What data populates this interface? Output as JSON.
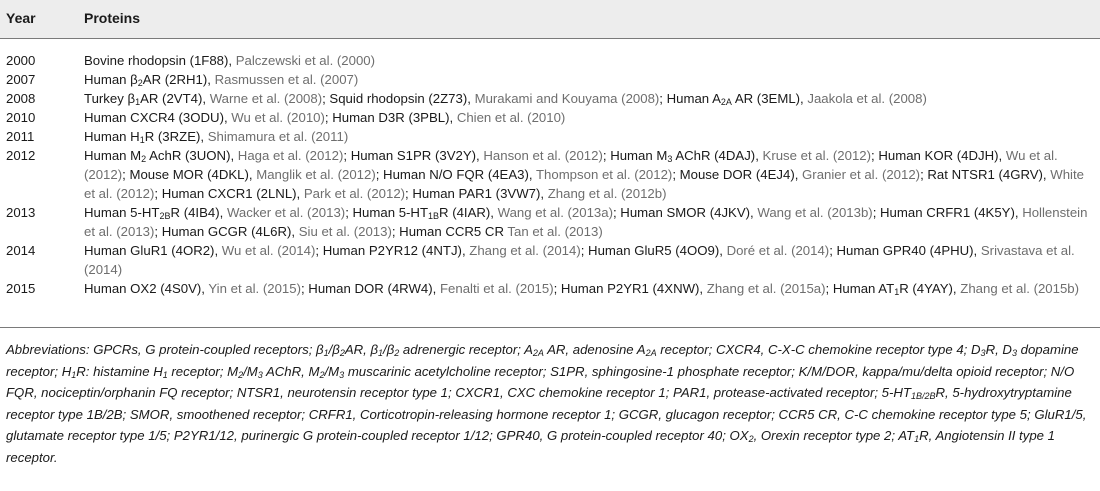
{
  "header": {
    "col_year": "Year",
    "col_proteins": "Proteins"
  },
  "rows": [
    {
      "year": "2000",
      "parts": [
        {
          "t": "Bovine rhodopsin (1F88), "
        },
        {
          "t": "Palczewski et al. (2000)",
          "c": 1
        }
      ]
    },
    {
      "year": "2007",
      "parts": [
        {
          "t": "Human β"
        },
        {
          "t": "2",
          "s": 1
        },
        {
          "t": "AR (2RH1), "
        },
        {
          "t": "Rasmussen et al. (2007)",
          "c": 1
        }
      ]
    },
    {
      "year": "2008",
      "parts": [
        {
          "t": "Turkey β"
        },
        {
          "t": "1",
          "s": 1
        },
        {
          "t": "AR (2VT4), "
        },
        {
          "t": "Warne et al. (2008)",
          "c": 1
        },
        {
          "t": "; Squid rhodopsin (2Z73), "
        },
        {
          "t": "Murakami and Kouyama (2008)",
          "c": 1
        },
        {
          "t": "; Human A"
        },
        {
          "t": "2A",
          "s": 1
        },
        {
          "t": " AR (3EML), "
        },
        {
          "t": "Jaakola et al. (2008)",
          "c": 1
        }
      ]
    },
    {
      "year": "2010",
      "parts": [
        {
          "t": "Human CXCR4 (3ODU), "
        },
        {
          "t": "Wu et al. (2010)",
          "c": 1
        },
        {
          "t": "; Human D3R (3PBL), "
        },
        {
          "t": "Chien et al. (2010)",
          "c": 1
        }
      ]
    },
    {
      "year": "2011",
      "parts": [
        {
          "t": "Human H"
        },
        {
          "t": "1",
          "s": 1
        },
        {
          "t": "R (3RZE), "
        },
        {
          "t": "Shimamura et al. (2011)",
          "c": 1
        }
      ]
    },
    {
      "year": "2012",
      "parts": [
        {
          "t": "Human M"
        },
        {
          "t": "2",
          "s": 1
        },
        {
          "t": " AchR (3UON), "
        },
        {
          "t": "Haga et al. (2012)",
          "c": 1
        },
        {
          "t": "; Human S1PR (3V2Y), "
        },
        {
          "t": "Hanson et al. (2012)",
          "c": 1
        },
        {
          "t": "; Human M"
        },
        {
          "t": "3",
          "s": 1
        },
        {
          "t": " AChR (4DAJ), "
        },
        {
          "t": "Kruse et al. (2012)",
          "c": 1
        },
        {
          "t": "; Human KOR (4DJH), "
        },
        {
          "t": "Wu et al. (2012)",
          "c": 1
        },
        {
          "t": "; Mouse MOR (4DKL), "
        },
        {
          "t": "Manglik et al. (2012)",
          "c": 1
        },
        {
          "t": "; Human N/O FQR (4EA3), "
        },
        {
          "t": "Thompson et al. (2012)",
          "c": 1
        },
        {
          "t": "; Mouse DOR (4EJ4), "
        },
        {
          "t": "Granier et al. (2012)",
          "c": 1
        },
        {
          "t": "; Rat NTSR1 (4GRV), "
        },
        {
          "t": "White et al. (2012)",
          "c": 1
        },
        {
          "t": "; Human CXCR1 (2LNL), "
        },
        {
          "t": "Park et al. (2012)",
          "c": 1
        },
        {
          "t": "; Human PAR1 (3VW7), "
        },
        {
          "t": "Zhang et al. (2012b)",
          "c": 1
        }
      ]
    },
    {
      "year": "2013",
      "parts": [
        {
          "t": "Human 5-HT"
        },
        {
          "t": "2B",
          "s": 1
        },
        {
          "t": "R (4IB4), "
        },
        {
          "t": "Wacker et al. (2013)",
          "c": 1
        },
        {
          "t": "; Human 5-HT"
        },
        {
          "t": "1B",
          "s": 1
        },
        {
          "t": "R (4IAR), "
        },
        {
          "t": "Wang et al. (2013a)",
          "c": 1
        },
        {
          "t": "; Human SMOR (4JKV), "
        },
        {
          "t": "Wang et al. (2013b)",
          "c": 1
        },
        {
          "t": "; Human CRFR1 (4K5Y), "
        },
        {
          "t": "Hollenstein et al. (2013)",
          "c": 1
        },
        {
          "t": "; Human GCGR (4L6R), "
        },
        {
          "t": "Siu et al. (2013)",
          "c": 1
        },
        {
          "t": "; Human CCR5 CR "
        },
        {
          "t": "Tan et al. (2013)",
          "c": 1
        }
      ]
    },
    {
      "year": "2014",
      "parts": [
        {
          "t": "Human GluR1 (4OR2), "
        },
        {
          "t": "Wu et al. (2014)",
          "c": 1
        },
        {
          "t": "; Human P2YR12 (4NTJ), "
        },
        {
          "t": "Zhang et al. (2014)",
          "c": 1
        },
        {
          "t": "; Human GluR5 (4OO9), "
        },
        {
          "t": "Doré et al. (2014)",
          "c": 1
        },
        {
          "t": "; Human GPR40 (4PHU), "
        },
        {
          "t": "Srivastava et al. (2014)",
          "c": 1
        }
      ]
    },
    {
      "year": "2015",
      "parts": [
        {
          "t": "Human OX2 (4S0V), "
        },
        {
          "t": "Yin et al. (2015)",
          "c": 1
        },
        {
          "t": "; Human DOR (4RW4), "
        },
        {
          "t": "Fenalti et al. (2015)",
          "c": 1
        },
        {
          "t": "; Human P2YR1 (4XNW), "
        },
        {
          "t": "Zhang et al. (2015a)",
          "c": 1
        },
        {
          "t": "; Human AT"
        },
        {
          "t": "1",
          "s": 1
        },
        {
          "t": "R (4YAY), "
        },
        {
          "t": "Zhang et al. (2015b)",
          "c": 1
        }
      ]
    }
  ],
  "abbreviations": [
    {
      "t": "Abbreviations: GPCRs, G protein-coupled receptors; β"
    },
    {
      "t": "1",
      "s": 1
    },
    {
      "t": "/β"
    },
    {
      "t": "2",
      "s": 1
    },
    {
      "t": "AR, β"
    },
    {
      "t": "1",
      "s": 1
    },
    {
      "t": "/β"
    },
    {
      "t": "2",
      "s": 1
    },
    {
      "t": " adrenergic receptor; A"
    },
    {
      "t": "2A",
      "s": 1
    },
    {
      "t": " AR, adenosine A"
    },
    {
      "t": "2A",
      "s": 1
    },
    {
      "t": " receptor; CXCR4, C-X-C chemokine receptor type 4; D"
    },
    {
      "t": "3",
      "s": 1
    },
    {
      "t": "R, D"
    },
    {
      "t": "3",
      "s": 1
    },
    {
      "t": " dopamine receptor; H"
    },
    {
      "t": "1",
      "s": 1
    },
    {
      "t": "R: histamine H"
    },
    {
      "t": "1",
      "s": 1
    },
    {
      "t": " receptor; M"
    },
    {
      "t": "2",
      "s": 1
    },
    {
      "t": "/M"
    },
    {
      "t": "3",
      "s": 1
    },
    {
      "t": " AChR, M"
    },
    {
      "t": "2",
      "s": 1
    },
    {
      "t": "/M"
    },
    {
      "t": "3",
      "s": 1
    },
    {
      "t": " muscarinic acetylcholine receptor; S1PR, sphingosine-1 phosphate receptor; K/M/DOR, kappa/mu/delta opioid receptor; N/O FQR, nociceptin/orphanin FQ receptor; NTSR1, neurotensin receptor type 1; CXCR1, CXC chemokine receptor 1; PAR1, protease-activated receptor; 5-HT"
    },
    {
      "t": "1B/2B",
      "s": 1
    },
    {
      "t": "R, 5-hydroxytryptamine receptor type 1B/2B; SMOR, smoothened receptor; CRFR1, Corticotropin-releasing hormone receptor 1; GCGR, glucagon receptor; CCR5 CR, C-C chemokine receptor type 5; GluR1/5, glutamate receptor type 1/5; P2YR1/12, purinergic G protein-coupled receptor 1/12; GPR40, G protein-coupled receptor 40; OX"
    },
    {
      "t": "2",
      "s": 1
    },
    {
      "t": ", Orexin receptor type 2; AT"
    },
    {
      "t": "1",
      "s": 1
    },
    {
      "t": "R, Angiotensin II type 1 receptor."
    }
  ]
}
